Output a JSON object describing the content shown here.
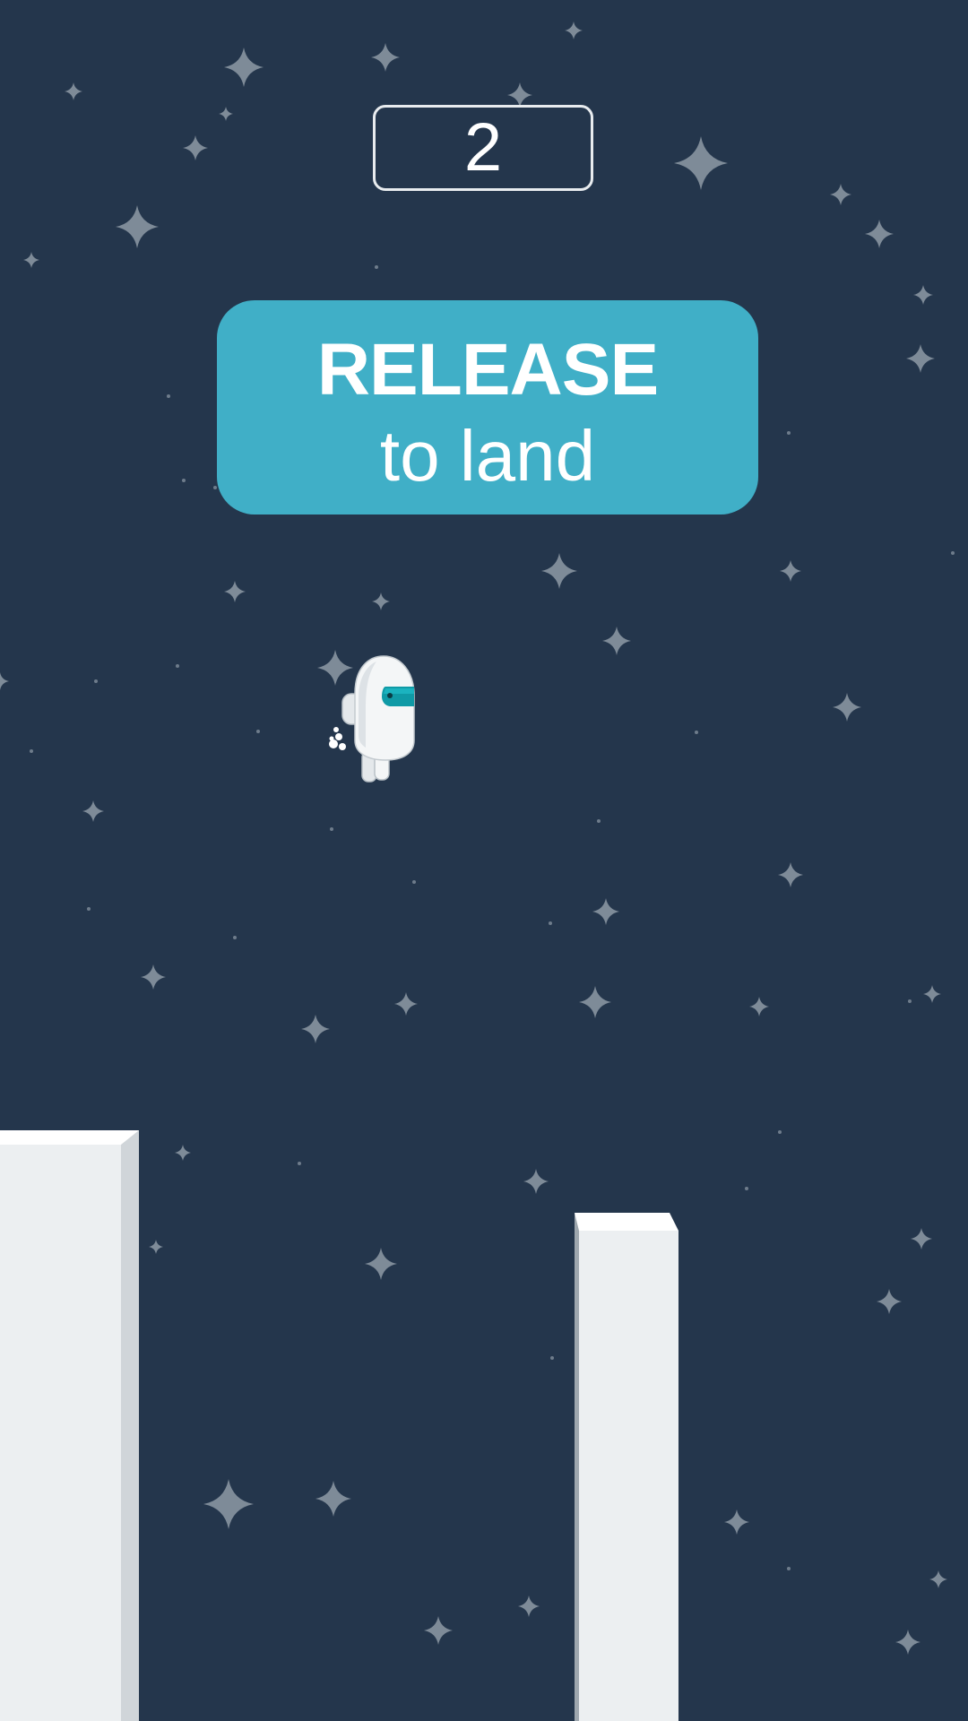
{
  "game": {
    "score": "2",
    "prompt": {
      "title": "RELEASE",
      "subtitle": "to land"
    }
  },
  "colors": {
    "background": "#24364c",
    "banner": "#40afc7",
    "pillar": "#eceff1",
    "pillar_side": "#d0d5d9",
    "visor": "#0f9aa6",
    "star": "#8e9aa6"
  }
}
